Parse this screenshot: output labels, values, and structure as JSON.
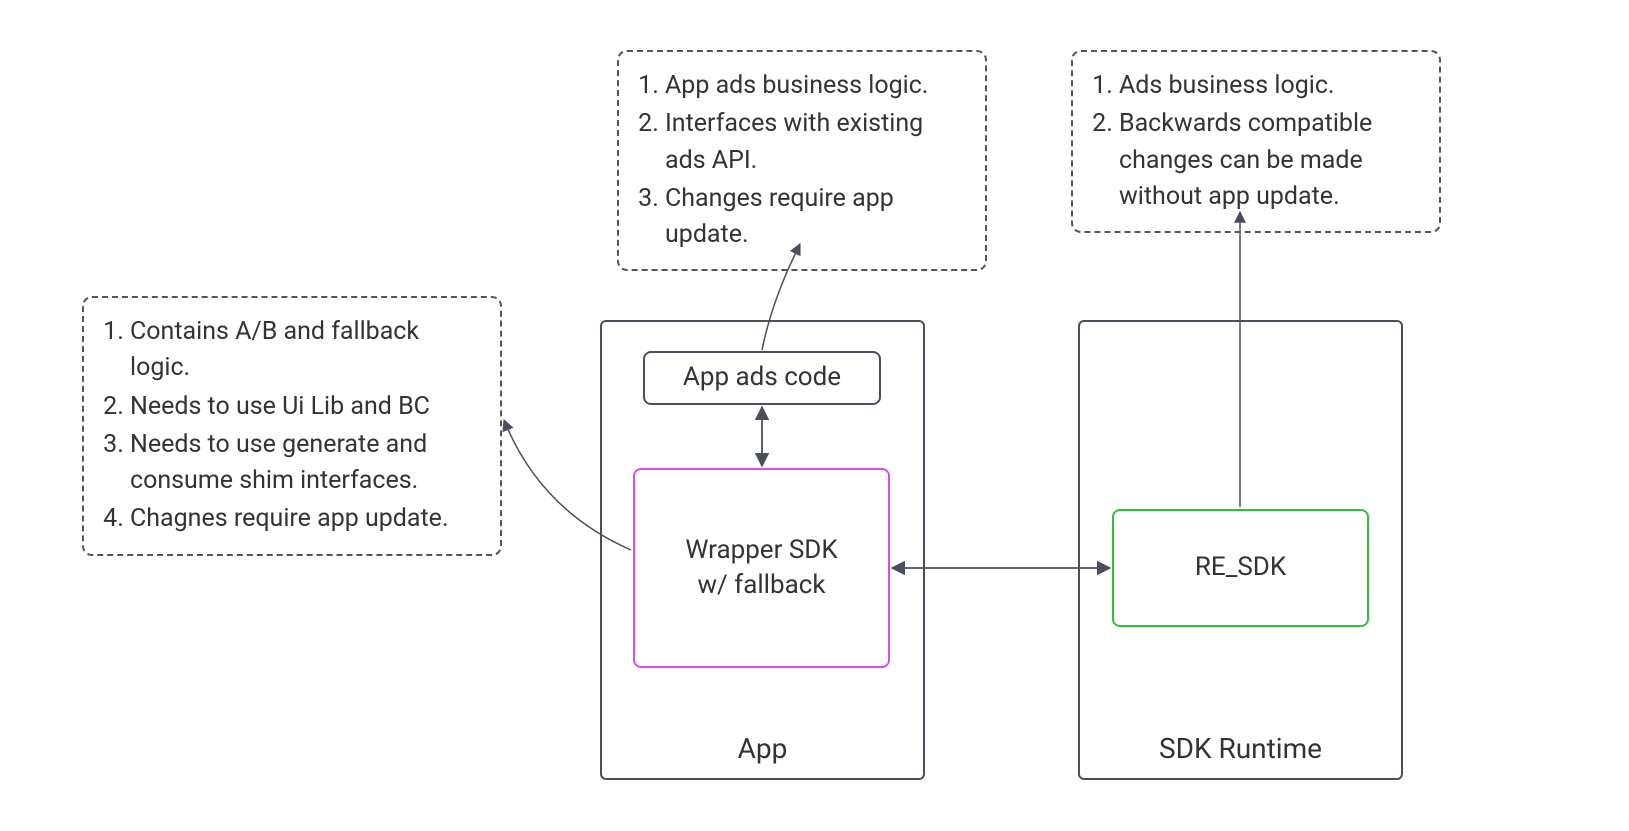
{
  "notes": {
    "wrapper": {
      "items": [
        "Contains A/B and fallback logic.",
        "Needs to use Ui Lib and BC",
        "Needs to use generate and consume shim interfaces.",
        "Chagnes require app update."
      ]
    },
    "appAds": {
      "items": [
        "App ads business logic.",
        "Interfaces with existing ads API.",
        "Changes require app update."
      ]
    },
    "reSdk": {
      "items": [
        "Ads business logic.",
        "Backwards compatible changes can be made without app update."
      ]
    }
  },
  "boxes": {
    "app": {
      "label": "App"
    },
    "sdkRuntime": {
      "label": "SDK Runtime"
    },
    "appAdsCode": {
      "label": "App ads code"
    },
    "wrapperSdk": {
      "line1": "Wrapper SDK",
      "line2": "w/ fallback"
    },
    "reSdk": {
      "label": "RE_SDK"
    }
  },
  "colors": {
    "containerBorder": "#4b4f5c",
    "boxBorder": "#4b4f5c",
    "magenta": "#d94fe0",
    "green": "#2fbf3a",
    "text": "#333333"
  }
}
